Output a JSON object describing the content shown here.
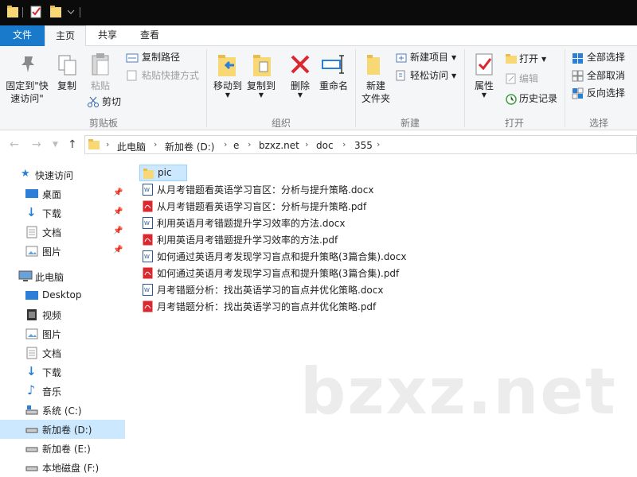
{
  "tabs": {
    "file": "文件",
    "home": "主页",
    "share": "共享",
    "view": "查看"
  },
  "ribbon": {
    "pin_quick_access": [
      "固定到\"快",
      "速访问\""
    ],
    "copy": "复制",
    "paste": "粘贴",
    "copy_path": "复制路径",
    "paste_shortcut": "粘贴快捷方式",
    "cut": "剪切",
    "group_clipboard": "剪贴板",
    "move_to": "移动到",
    "copy_to": "复制到",
    "delete": "删除",
    "rename": "重命名",
    "group_organize": "组织",
    "new_folder": [
      "新建",
      "文件夹"
    ],
    "new_item": "新建项目",
    "easy_access": "轻松访问",
    "group_new": "新建",
    "properties": "属性",
    "open": "打开",
    "edit": "编辑",
    "history": "历史记录",
    "group_open": "打开",
    "select_all": "全部选择",
    "select_none": "全部取消",
    "invert_selection": "反向选择",
    "group_select": "选择"
  },
  "breadcrumb": [
    "此电脑",
    "新加卷 (D:)",
    "e",
    "bzxz.net",
    "doc",
    "355"
  ],
  "nav": {
    "quick_access": "快速访问",
    "quick_items": [
      "桌面",
      "下载",
      "文档",
      "图片"
    ],
    "this_pc": "此电脑",
    "pc_items": [
      "Desktop",
      "视频",
      "图片",
      "文档",
      "下载",
      "音乐",
      "系统 (C:)",
      "新加卷 (D:)",
      "新加卷 (E:)",
      "本地磁盘 (F:)"
    ]
  },
  "files": [
    {
      "name": "pic",
      "type": "folder"
    },
    {
      "name": "从月考错题看英语学习盲区：分析与提升策略.docx",
      "type": "docx"
    },
    {
      "name": "从月考错题看英语学习盲区：分析与提升策略.pdf",
      "type": "pdf"
    },
    {
      "name": "利用英语月考错题提升学习效率的方法.docx",
      "type": "docx"
    },
    {
      "name": "利用英语月考错题提升学习效率的方法.pdf",
      "type": "pdf"
    },
    {
      "name": "如何通过英语月考发现学习盲点和提升策略(3篇合集).docx",
      "type": "docx"
    },
    {
      "name": "如何通过英语月考发现学习盲点和提升策略(3篇合集).pdf",
      "type": "pdf"
    },
    {
      "name": "月考错题分析：找出英语学习的盲点并优化策略.docx",
      "type": "docx"
    },
    {
      "name": "月考错题分析：找出英语学习的盲点并优化策略.pdf",
      "type": "pdf"
    }
  ],
  "watermark": "bzxz.net",
  "colors": {
    "accent": "#1979ca",
    "selected": "#cce8ff",
    "folder": "#f8d775",
    "pdf": "#d9282f",
    "word": "#2b5797"
  }
}
